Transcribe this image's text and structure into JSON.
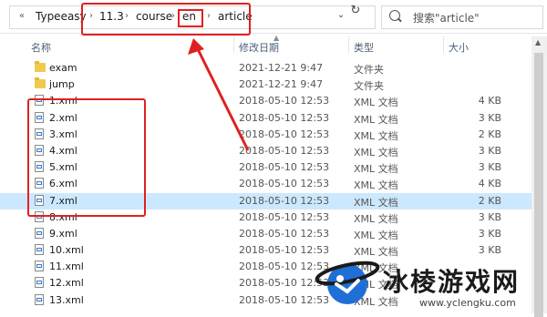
{
  "addressbar": {
    "path": [
      "Typeeasy",
      "11.3",
      "course",
      "en",
      "article"
    ],
    "nav_glyph": "«",
    "separator_glyph": "›",
    "refresh_glyph": "↻",
    "dropdown_glyph": "⌄"
  },
  "search": {
    "text": "搜索\"article\""
  },
  "columns": {
    "name": "名称",
    "date": "修改日期",
    "type": "类型",
    "size": "大小"
  },
  "files": [
    {
      "icon": "folder-icon",
      "name": "exam",
      "date": "2021-12-21 9:47",
      "type": "文件夹",
      "size": ""
    },
    {
      "icon": "folder-icon",
      "name": "jump",
      "date": "2021-12-21 9:47",
      "type": "文件夹",
      "size": ""
    },
    {
      "icon": "xml-file-icon",
      "name": "1.xml",
      "date": "2018-05-10 12:53",
      "type": "XML 文档",
      "size": "4 KB"
    },
    {
      "icon": "xml-file-icon",
      "name": "2.xml",
      "date": "2018-05-10 12:53",
      "type": "XML 文档",
      "size": "3 KB"
    },
    {
      "icon": "xml-file-icon",
      "name": "3.xml",
      "date": "2018-05-10 12:53",
      "type": "XML 文档",
      "size": "2 KB"
    },
    {
      "icon": "xml-file-icon",
      "name": "4.xml",
      "date": "2018-05-10 12:53",
      "type": "XML 文档",
      "size": "3 KB"
    },
    {
      "icon": "xml-file-icon",
      "name": "5.xml",
      "date": "2018-05-10 12:53",
      "type": "XML 文档",
      "size": "3 KB"
    },
    {
      "icon": "xml-file-icon",
      "name": "6.xml",
      "date": "2018-05-10 12:53",
      "type": "XML 文档",
      "size": "4 KB"
    },
    {
      "icon": "xml-file-icon",
      "name": "7.xml",
      "date": "2018-05-10 12:53",
      "type": "XML 文档",
      "size": "2 KB"
    },
    {
      "icon": "xml-file-icon",
      "name": "8.xml",
      "date": "2018-05-10 12:53",
      "type": "XML 文档",
      "size": "3 KB"
    },
    {
      "icon": "xml-file-icon",
      "name": "9.xml",
      "date": "2018-05-10 12:53",
      "type": "XML 文档",
      "size": "3 KB"
    },
    {
      "icon": "xml-file-icon",
      "name": "10.xml",
      "date": "2018-05-10 12:53",
      "type": "XML 文档",
      "size": "3 KB"
    },
    {
      "icon": "xml-file-icon",
      "name": "11.xml",
      "date": "2018-05-10 12:53",
      "type": "XML 文档",
      "size": ""
    },
    {
      "icon": "xml-file-icon",
      "name": "12.xml",
      "date": "2018-05-10 12:53",
      "type": "XML 文档",
      "size": ""
    },
    {
      "icon": "xml-file-icon",
      "name": "13.xml",
      "date": "2018-05-10 12:53",
      "type": "XML 文档",
      "size": ""
    }
  ],
  "selected_file": "7.xml",
  "colors": {
    "annotation": "#e02020",
    "selection": "#cce8ff",
    "header_text": "#4c607a",
    "watermark_blue": "#1f6fd6"
  },
  "watermark": {
    "title": "冰棱游戏网",
    "url": "www.yclengku.com"
  }
}
